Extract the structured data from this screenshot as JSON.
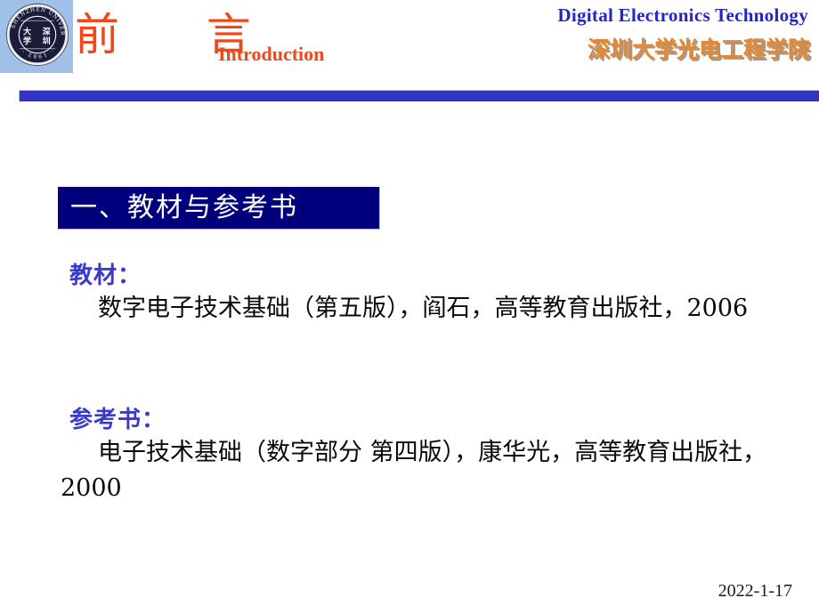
{
  "slide": {
    "date_stamp": "2022-1-17"
  },
  "header": {
    "title_cn": "前  言",
    "title_en": "Introduction",
    "course_title_en": "Digital Electronics Technology",
    "school_name_cn": "深圳大学光电工程学院",
    "logo": {
      "name": "shenzhen-university-seal",
      "outer_text_en": "SHENZHEN UNIVERSITY",
      "inner_text_cn": "深圳大学",
      "year": "1983",
      "tile_bg": "#9fc0e8",
      "seal_color": "#1b1b3a"
    },
    "rule_color": "#3333c4",
    "title_color": "#f0481a",
    "course_color": "#2424c8",
    "school_color": "#e8882e"
  },
  "section": {
    "heading": "一、教材与参考书",
    "box_bg": "#00007c",
    "box_text_color": "#ffffff"
  },
  "content": {
    "textbook": {
      "label": "教材：",
      "text": "数字电子技术基础（第五版），阎石，高等教育出版社，2006"
    },
    "reference": {
      "label": "参考书：",
      "text": "电子技术基础（数字部分 第四版），康华光，高等教育出版社，2000"
    },
    "label_color": "#3a3acc",
    "text_color": "#0b0b0b"
  }
}
